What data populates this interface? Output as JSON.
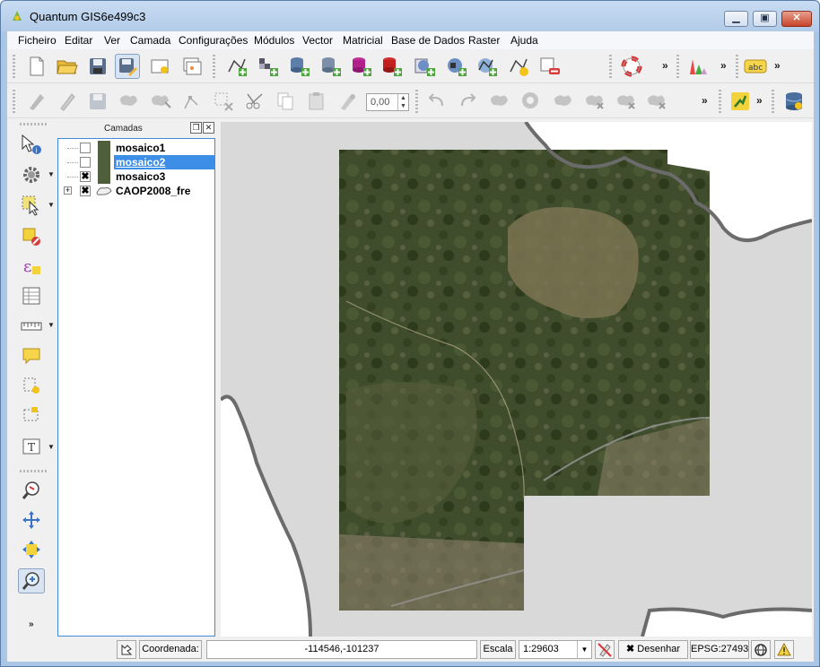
{
  "window": {
    "title": "Quantum GIS6e499c3"
  },
  "menu": [
    "Ficheiro",
    "Editar",
    "Ver",
    "Camada",
    "Configurações",
    "Módulos",
    "Vector",
    "Matricial",
    "Base de Dados",
    "Raster",
    "Ajuda"
  ],
  "toolbar2": {
    "scale_value": "0,00"
  },
  "layers_panel": {
    "title": "Camadas",
    "layers": [
      {
        "name": "mosaico1",
        "checked": false,
        "selected": false
      },
      {
        "name": "mosaico2",
        "checked": false,
        "selected": true
      },
      {
        "name": "mosaico3",
        "checked": true,
        "selected": false
      },
      {
        "name": "CAOP2008_fre",
        "checked": true,
        "selected": false
      }
    ]
  },
  "statusbar": {
    "coord_label": "Coordenada:",
    "coord_value": "-114546,-101237",
    "scale_label": "Escala",
    "scale_value": "1:29603",
    "render_label": "Desenhar",
    "crs": "EPSG:27493"
  },
  "colors": {
    "selection": "#3d8ee6",
    "map_background": "#d9d9d9",
    "boundary": "#6b6b6b",
    "raster_forest": "#3f4d2c"
  }
}
